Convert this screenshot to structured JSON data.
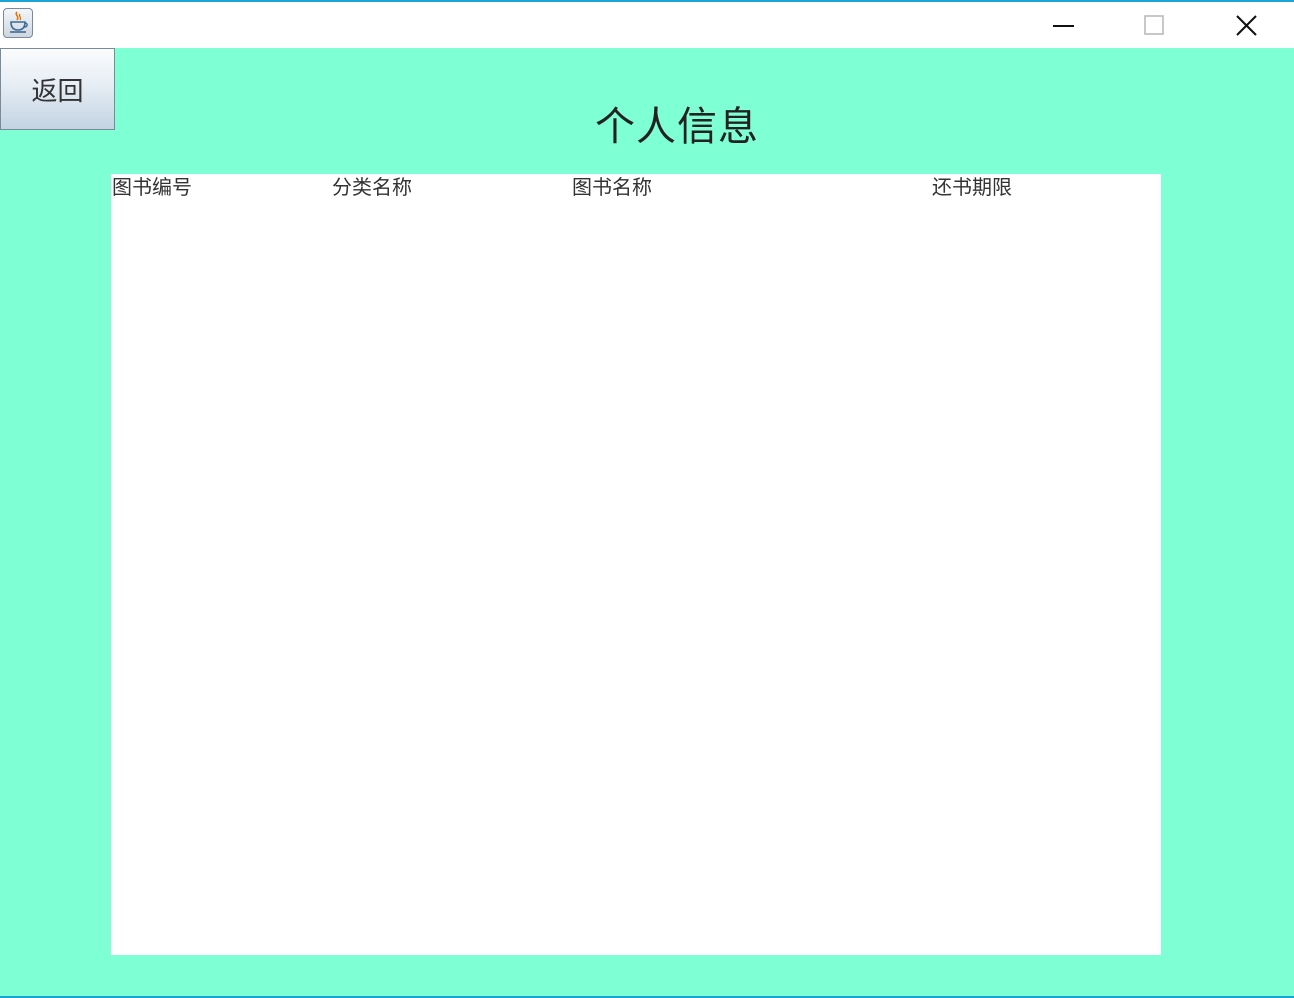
{
  "window": {
    "app_icon": "java-coffee-cup-icon",
    "controls": {
      "minimize_icon": "minimize-icon",
      "maximize_icon": "maximize-icon",
      "close_icon": "close-icon"
    }
  },
  "toolbar": {
    "back_label": "返回"
  },
  "page": {
    "title": "个人信息"
  },
  "table": {
    "columns": [
      "图书编号",
      "分类名称",
      "图书名称",
      "还书期限"
    ],
    "rows": []
  },
  "colors": {
    "background": "#7fffd4",
    "panel": "#ffffff",
    "window_accent": "#1aa4d6"
  }
}
